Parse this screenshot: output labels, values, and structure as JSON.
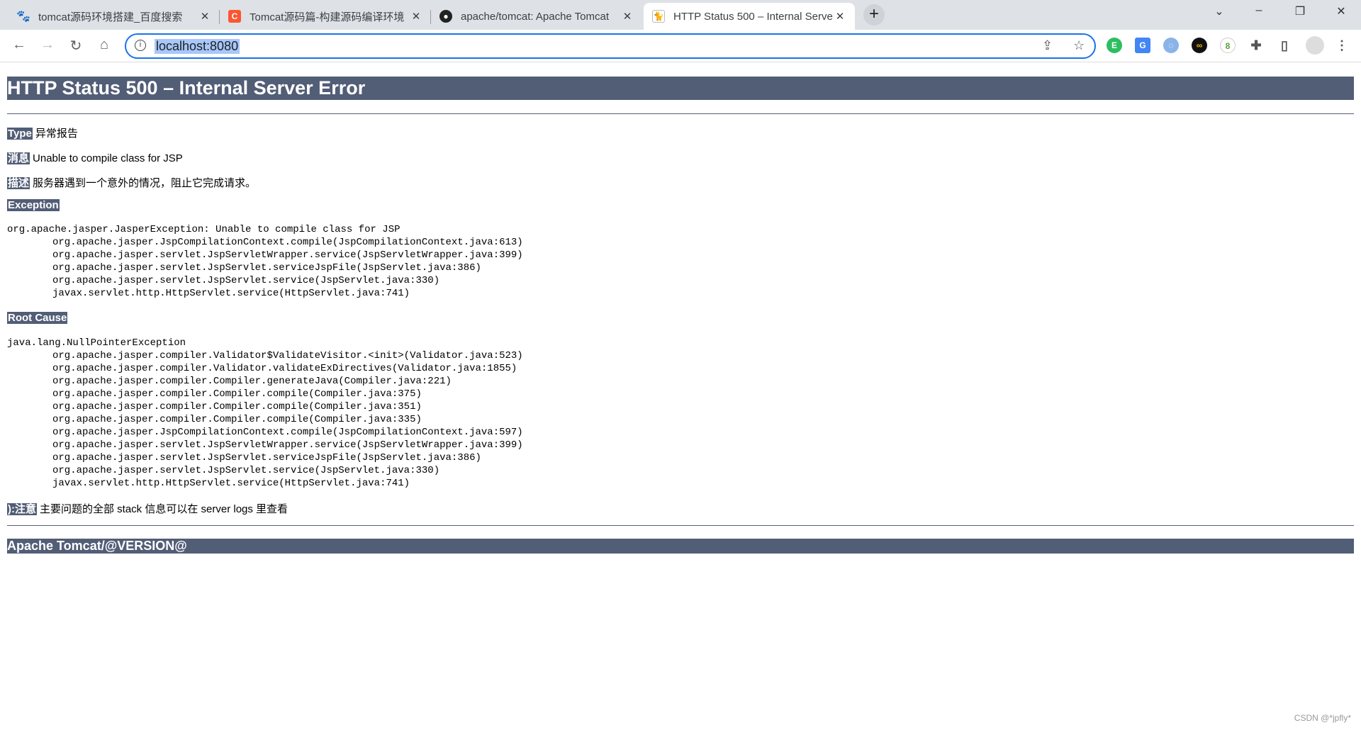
{
  "browser": {
    "tabs": [
      {
        "title": "tomcat源码环境搭建_百度搜索",
        "icon": "baidu-paw-icon"
      },
      {
        "title": "Tomcat源码篇-构建源码编译环境",
        "icon": "csdn-icon"
      },
      {
        "title": "apache/tomcat: Apache Tomcat",
        "icon": "github-icon"
      },
      {
        "title": "HTTP Status 500 – Internal Server Error",
        "icon": "tomcat-icon",
        "active": true
      }
    ],
    "address": "localhost:8080",
    "extensions": [
      "evernote-icon",
      "google-translate-icon",
      "ext-swirl-icon",
      "infinity-icon",
      "ext-badge-icon",
      "puzzle-icon",
      "sidepanel-icon",
      "profile-avatar"
    ]
  },
  "page": {
    "title": "HTTP Status 500 – Internal Server Error",
    "type_label": "Type",
    "type_value": "异常报告",
    "message_label": "消息",
    "message_value": "Unable to compile class for JSP",
    "description_label": "描述",
    "description_value": "服务器遇到一个意外的情况，阻止它完成请求。",
    "exception_label": "Exception",
    "exception_head": "org.apache.jasper.JasperException: Unable to compile class for JSP",
    "exception_trace": [
      "org.apache.jasper.JspCompilationContext.compile(JspCompilationContext.java:613)",
      "org.apache.jasper.servlet.JspServletWrapper.service(JspServletWrapper.java:399)",
      "org.apache.jasper.servlet.JspServlet.serviceJspFile(JspServlet.java:386)",
      "org.apache.jasper.servlet.JspServlet.service(JspServlet.java:330)",
      "javax.servlet.http.HttpServlet.service(HttpServlet.java:741)"
    ],
    "root_cause_label": "Root Cause",
    "root_cause_head": "java.lang.NullPointerException",
    "root_cause_trace": [
      "org.apache.jasper.compiler.Validator$ValidateVisitor.<init>(Validator.java:523)",
      "org.apache.jasper.compiler.Validator.validateExDirectives(Validator.java:1855)",
      "org.apache.jasper.compiler.Compiler.generateJava(Compiler.java:221)",
      "org.apache.jasper.compiler.Compiler.compile(Compiler.java:375)",
      "org.apache.jasper.compiler.Compiler.compile(Compiler.java:351)",
      "org.apache.jasper.compiler.Compiler.compile(Compiler.java:335)",
      "org.apache.jasper.JspCompilationContext.compile(JspCompilationContext.java:597)",
      "org.apache.jasper.servlet.JspServletWrapper.service(JspServletWrapper.java:399)",
      "org.apache.jasper.servlet.JspServlet.serviceJspFile(JspServlet.java:386)",
      "org.apache.jasper.servlet.JspServlet.service(JspServlet.java:330)",
      "javax.servlet.http.HttpServlet.service(HttpServlet.java:741)"
    ],
    "note_label": "):注意",
    "note_value": "主要问题的全部 stack 信息可以在 server logs 里查看",
    "footer": "Apache Tomcat/@VERSION@"
  },
  "watermark": "CSDN @*jpfly*",
  "colors": {
    "header_bg": "#525d76",
    "accent": "#1a73e8"
  }
}
